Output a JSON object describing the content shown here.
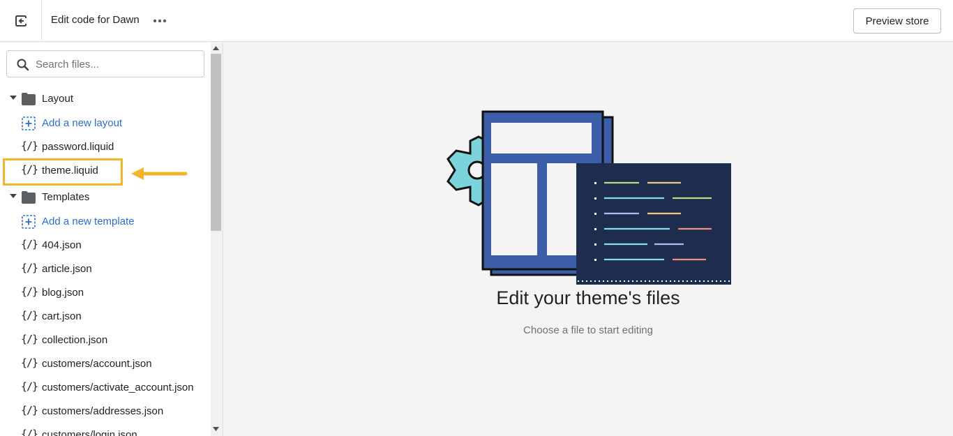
{
  "topbar": {
    "exit_icon": "exit-icon",
    "title": "Edit code for Dawn",
    "more_icon": "horizontal-dots-icon",
    "preview_label": "Preview store"
  },
  "search": {
    "placeholder": "Search files...",
    "value": "",
    "icon": "search-icon"
  },
  "tree": {
    "layout_folder": "Layout",
    "add_layout": "Add a new layout",
    "layout_files": [
      "password.liquid",
      "theme.liquid"
    ],
    "templates_folder": "Templates",
    "add_template": "Add a new template",
    "template_files": [
      "404.json",
      "article.json",
      "blog.json",
      "cart.json",
      "collection.json",
      "customers/account.json",
      "customers/activate_account.json",
      "customers/addresses.json",
      "customers/login.json"
    ],
    "highlighted_file": "theme.liquid"
  },
  "empty_state": {
    "title": "Edit your theme's files",
    "subtitle": "Choose a file to start editing"
  },
  "colors": {
    "link": "#2c6ecb",
    "highlight": "#f3b52b",
    "illustration_blue": "#3c5ea8",
    "illustration_navy": "#1e2d4d",
    "illustration_teal": "#7dd3dc"
  }
}
